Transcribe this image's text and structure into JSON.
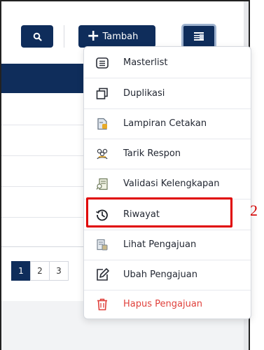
{
  "toolbar": {
    "search_icon": "search-icon",
    "add_label": "Tambah",
    "add_icon": "plus-icon",
    "menu_icon": "list-menu-icon"
  },
  "pagination": {
    "pages": [
      "1",
      "2",
      "3"
    ],
    "active": "1"
  },
  "menu": {
    "items": [
      {
        "label": "Masterlist",
        "icon": "list-box-icon"
      },
      {
        "label": "Duplikasi",
        "icon": "copy-icon"
      },
      {
        "label": "Lampiran Cetakan",
        "icon": "document-attachment-icon"
      },
      {
        "label": "Tarik Respon",
        "icon": "people-response-icon"
      },
      {
        "label": "Validasi Kelengkapan",
        "icon": "validation-document-icon"
      },
      {
        "label": "Riwayat",
        "icon": "history-icon"
      },
      {
        "label": "Lihat Pengajuan",
        "icon": "view-document-icon"
      },
      {
        "label": "Ubah Pengajuan",
        "icon": "edit-icon"
      },
      {
        "label": "Hapus Pengajuan",
        "icon": "trash-icon"
      }
    ]
  },
  "annotation": {
    "step_number": "2",
    "highlight_color": "#e00000"
  },
  "colors": {
    "primary": "#0f2d5b",
    "danger": "#e0403b"
  }
}
